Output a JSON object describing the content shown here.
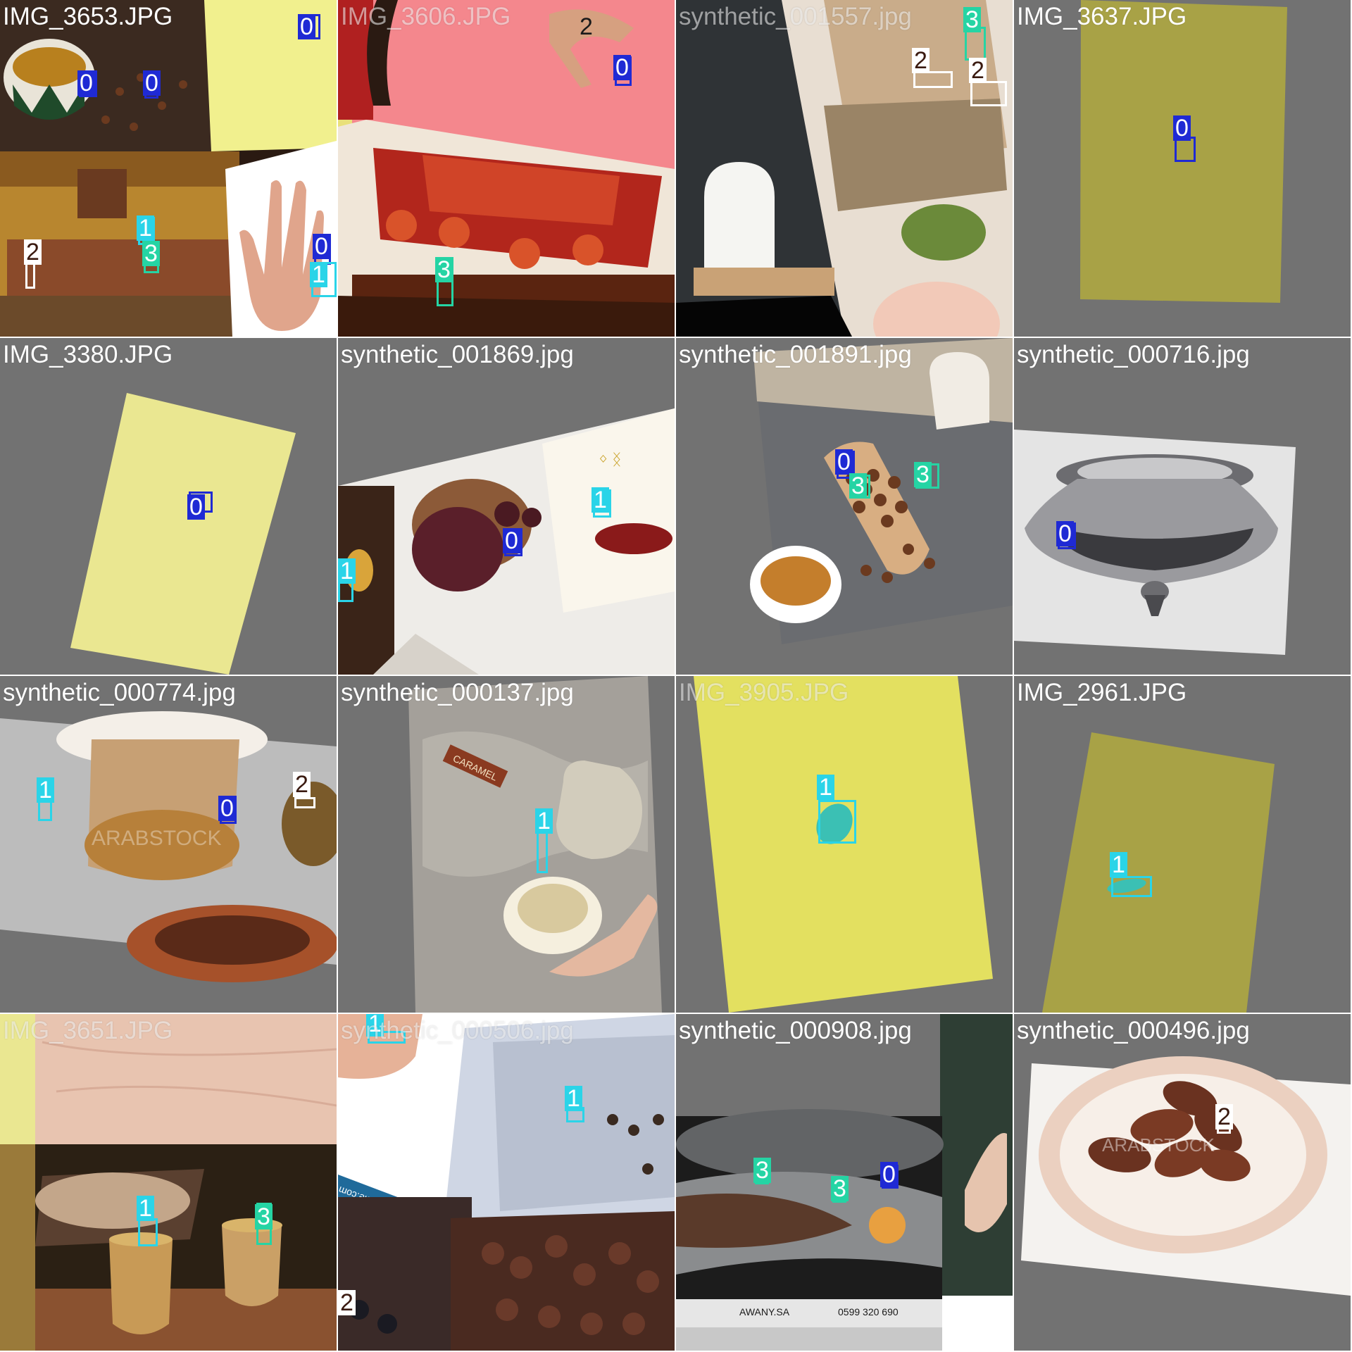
{
  "class_colors": {
    "0": "#1f2ad4",
    "1": "#2ad4e8",
    "2": "#ffffff",
    "3": "#25d4a4"
  },
  "tiles": [
    {
      "label": "IMG_3653.JPG",
      "tags": [
        "0",
        "0",
        "0",
        "1",
        "3",
        "2",
        "0",
        "1"
      ]
    },
    {
      "label": "IMG_3606.JPG",
      "tags": [
        "2",
        "0",
        "3"
      ]
    },
    {
      "label": "synthetic_001557.jpg",
      "tags": [
        "3",
        "2",
        "2"
      ]
    },
    {
      "label": "IMG_3637.JPG",
      "tags": [
        "0"
      ]
    },
    {
      "label": "IMG_3380.JPG",
      "tags": [
        "0"
      ]
    },
    {
      "label": "synthetic_001869.jpg",
      "tags": [
        "1",
        "0",
        "1"
      ]
    },
    {
      "label": "synthetic_001891.jpg",
      "tags": [
        "0",
        "3",
        "3"
      ]
    },
    {
      "label": "synthetic_000716.jpg",
      "tags": [
        "0"
      ]
    },
    {
      "label": "synthetic_000774.jpg",
      "tags": [
        "1",
        "0",
        "2"
      ],
      "watermark": "ARABSTOCK"
    },
    {
      "label": "synthetic_000137.jpg",
      "tags": [
        "1"
      ],
      "wrapper_text": "CARAMEL"
    },
    {
      "label": "IMG_3905.JPG",
      "tags": [
        "1"
      ]
    },
    {
      "label": "IMG_2961.JPG",
      "tags": [
        "1"
      ]
    },
    {
      "label": "IMG_3651.JPG",
      "tags": [
        "1",
        "3"
      ]
    },
    {
      "label": "synthetic_000506.jpg",
      "tags": [
        "1",
        "1",
        "2"
      ],
      "site_text": "dreamstime.com"
    },
    {
      "label": "synthetic_000908.jpg",
      "tags": [
        "3",
        "3",
        "0"
      ],
      "footer_text": "0599 320 690",
      "brand_text": "AWANY.SA"
    },
    {
      "label": "synthetic_000496.jpg",
      "tags": [
        "2"
      ],
      "watermark": "ARABSTOCK"
    }
  ]
}
